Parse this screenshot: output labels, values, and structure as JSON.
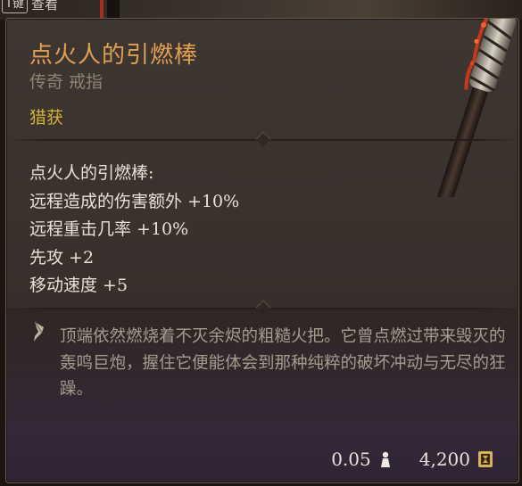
{
  "key_hint": {
    "key": "T键",
    "label": "查看"
  },
  "item": {
    "name": "点火人的引燃棒",
    "type": "传奇 戒指",
    "tag": "猎获"
  },
  "properties": [
    "点火人的引燃棒:",
    "远程造成的伤害额外 +10%",
    "远程重击几率 +10%",
    "先攻 +2",
    "移动速度 +5"
  ],
  "description": "顶端依然燃烧着不灭余烬的粗糙火把。它曾点燃过带来毁灭的轰鸣巨炮，握住它便能体会到那种纯粹的破坏冲动与无尽的狂躁。",
  "footer": {
    "weight": "0.05",
    "weight_icon": "weight-icon",
    "value": "4,200",
    "value_icon": "gold-coin-icon"
  },
  "colors": {
    "title": "#e2a055",
    "type": "#8f8372",
    "tag": "#d8b236",
    "property": "#e7e1d6",
    "description": "#a59b8e"
  }
}
